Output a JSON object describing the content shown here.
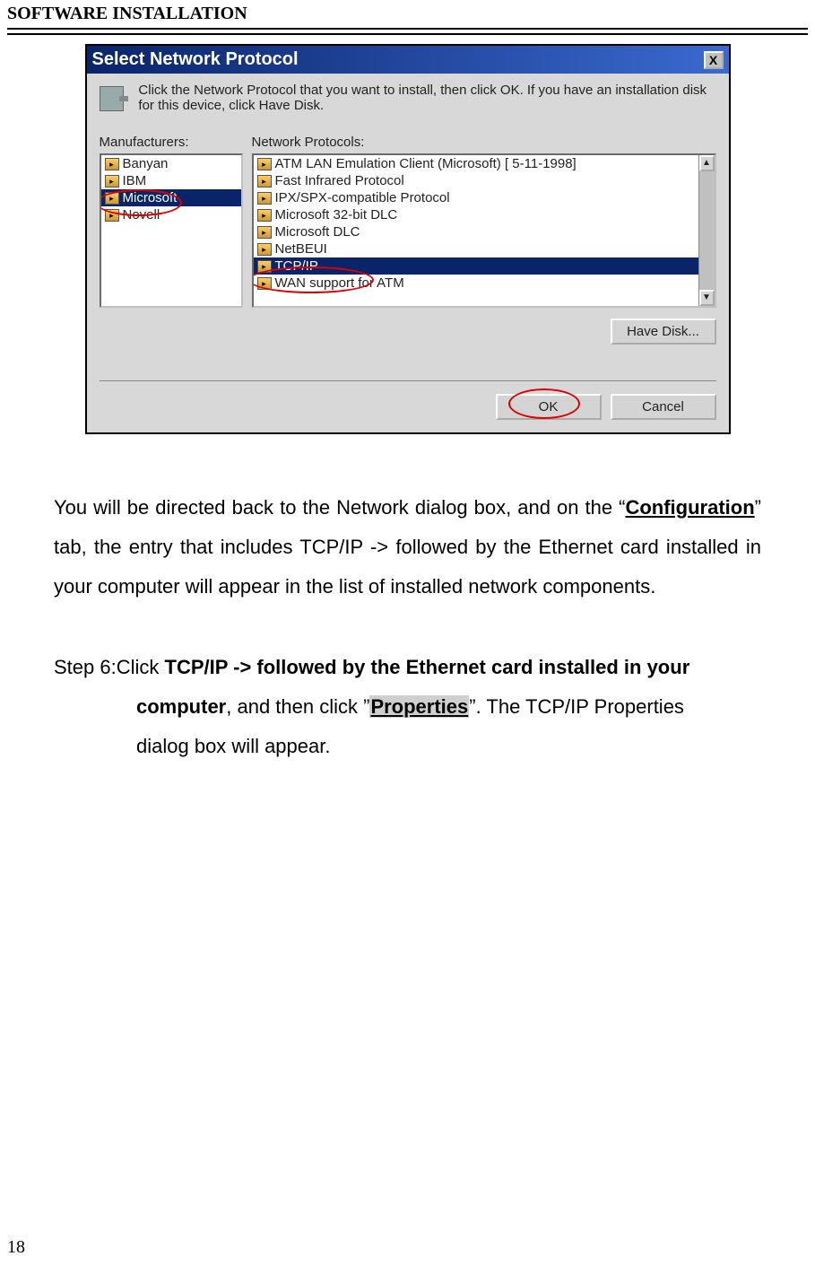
{
  "header": "SOFTWARE INSTALLATION",
  "page_number": "18",
  "dialog": {
    "title": "Select Network Protocol",
    "close_label": "X",
    "instruction": "Click the Network Protocol that you want to install, then click OK. If you have an installation disk for this device, click Have Disk.",
    "manufacturers_label": "Manufacturers:",
    "protocols_label": "Network Protocols:",
    "manufacturers": [
      "Banyan",
      "IBM",
      "Microsoft",
      "Novell"
    ],
    "protocols": [
      "ATM LAN Emulation Client (Microsoft) [ 5-11-1998]",
      "Fast Infrared Protocol",
      "IPX/SPX-compatible Protocol",
      "Microsoft 32-bit DLC",
      "Microsoft DLC",
      "NetBEUI",
      "TCP/IP",
      "WAN support for ATM"
    ],
    "selected_manufacturer_index": 2,
    "selected_protocol_index": 6,
    "have_disk_label": "Have Disk...",
    "ok_label": "OK",
    "cancel_label": "Cancel"
  },
  "para": {
    "p1_a": "You will be directed back to the Network dialog box, and on the “",
    "config": "Configuration",
    "p1_b": "” tab, the entry that includes TCP/IP -> followed by the Ethernet card installed in your computer will appear in the list of installed network components.",
    "step_prefix": "Step 6:Click ",
    "step_bold1": "TCP/IP -> followed by the Ethernet card installed in your",
    "step_bold2": "computer",
    "step_mid": ", and then click ”",
    "properties": "Properties",
    "step_after": "”. The TCP/IP Properties",
    "step_last": "dialog box will appear."
  }
}
